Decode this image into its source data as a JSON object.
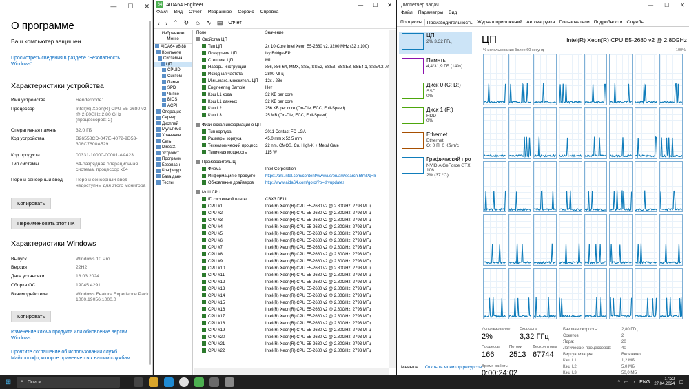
{
  "settings": {
    "title": "О программе",
    "protected": "Ваш компьютер защищен.",
    "security_link": "Просмотреть сведения в разделе \"Безопасность Windows\"",
    "device_specs_title": "Характеристики устройства",
    "device_specs": [
      {
        "k": "Имя устройства",
        "v": "Rendernode1"
      },
      {
        "k": "Процессор",
        "v": "Intel(R) Xeon(R) CPU E5-2680 v2 @ 2.80GHz   2.80 GHz (процессоров: 2)"
      },
      {
        "k": "Оперативная память",
        "v": "32,0 ГБ"
      },
      {
        "k": "Код устройства",
        "v": "B26558CD-047E-4072-9D53-308C7600A529"
      },
      {
        "k": "Код продукта",
        "v": "00331-10000-00001-AA423"
      },
      {
        "k": "Тип системы",
        "v": "64-разрядная операционная система, процессор x64"
      },
      {
        "k": "Перо и сенсорный ввод",
        "v": "Перо и сенсорный ввод недоступны для этого монитора"
      }
    ],
    "copy_label": "Копировать",
    "rename_label": "Переименовать этот ПК",
    "win_specs_title": "Характеристики Windows",
    "win_specs": [
      {
        "k": "Выпуск",
        "v": "Windows 10 Pro"
      },
      {
        "k": "Версия",
        "v": "22H2"
      },
      {
        "k": "Дата установки",
        "v": "18.03.2024"
      },
      {
        "k": "Сборка ОС",
        "v": "19045.4291"
      },
      {
        "k": "Взаимодействие",
        "v": "Windows Feature Experience Pack 1000.19056.1000.0"
      }
    ],
    "copy2_label": "Копировать",
    "link_change_key": "Изменение ключа продукта или обновление версии Windows",
    "link_agreement": "Прочтите соглашение об использовании служб Майкрософт, которое применяется к нашим службам"
  },
  "aida": {
    "title": "AIDA64 Engineer",
    "menu": [
      "Файл",
      "Вид",
      "Отчёт",
      "Избранное",
      "Сервис",
      "Справка"
    ],
    "report": "Отчёт",
    "fav": "Избранное",
    "menu_label": "Меню",
    "tree": [
      "AIDA64 v6.88",
      "Компьюте",
      "Системна",
      "ЦП",
      "CPUID",
      "Систем",
      "Памят",
      "SPD",
      "Чипсе",
      "BIOS",
      "ACPI",
      "Операцио",
      "Сервер",
      "Дисплей",
      "Мультиме",
      "Хранение",
      "Сеть",
      "DirectX",
      "Устройст",
      "Программ",
      "Безопасн",
      "Конфигур",
      "База данн",
      "Тесты"
    ],
    "col_field": "Поле",
    "col_value": "Значение",
    "groups": [
      {
        "name": "Свойства ЦП",
        "rows": [
          {
            "f": "Тип ЦП",
            "v": "2x 10-Core Intel Xeon E5-2680 v2, 3200 MHz (32 x 100)"
          },
          {
            "f": "Псевдоним ЦП",
            "v": "Ivy Bridge-EP"
          },
          {
            "f": "Степпинг ЦП",
            "v": "M1"
          },
          {
            "f": "Наборы инструкций",
            "v": "x86, x86-64, MMX, SSE, SSE2, SSE3, SSSE3, SSE4.1, SSE4.2, AVX, AE"
          },
          {
            "f": "Исходная частота",
            "v": "2800 МГц"
          },
          {
            "f": "Мин./макс. множитель ЦП",
            "v": "12x / 28x"
          },
          {
            "f": "Engineering Sample",
            "v": "Нет"
          },
          {
            "f": "Кэш L1 кода",
            "v": "32 KB per core"
          },
          {
            "f": "Кэш L1 данных",
            "v": "32 KB per core"
          },
          {
            "f": "Кэш L2",
            "v": "256 KB per core  (On-Die, ECC, Full-Speed)"
          },
          {
            "f": "Кэш L3",
            "v": "25 MB  (On-Die, ECC, Full-Speed)"
          }
        ]
      },
      {
        "name": "Физическая информация о ЦП",
        "rows": [
          {
            "f": "Тип корпуса",
            "v": "2011 Contact FC-LGA"
          },
          {
            "f": "Размеры корпуса",
            "v": "45.0 mm x 52.5 mm"
          },
          {
            "f": "Технологический процесс",
            "v": "22 nm, CMOS, Cu, High-K + Metal Gate"
          },
          {
            "f": "Типичная мощность",
            "v": "115 W"
          }
        ]
      },
      {
        "name": "Производитель ЦП",
        "rows": [
          {
            "f": "Фирма",
            "v": "Intel Corporation"
          },
          {
            "f": "Информация о продукте",
            "v": "https://ark.intel.com/content/www/us/en/ark/search.html?q=Ir",
            "link": true
          },
          {
            "f": "Обновление драйверов",
            "v": "http://www.aida64.com/goto/?p=drvupdates",
            "link": true
          }
        ]
      },
      {
        "name": "Multi CPU",
        "rows": [
          {
            "f": "ID системной платы",
            "v": "CBX3 DELL"
          },
          {
            "f": "CPU #1",
            "v": "Intel(R) Xeon(R) CPU E5-2680 v2 @ 2.80GHz, 2793 МГц"
          },
          {
            "f": "CPU #2",
            "v": "Intel(R) Xeon(R) CPU E5-2680 v2 @ 2.80GHz, 2793 МГц"
          },
          {
            "f": "CPU #3",
            "v": "Intel(R) Xeon(R) CPU E5-2680 v2 @ 2.80GHz, 2793 МГц"
          },
          {
            "f": "CPU #4",
            "v": "Intel(R) Xeon(R) CPU E5-2680 v2 @ 2.80GHz, 2793 МГц"
          },
          {
            "f": "CPU #5",
            "v": "Intel(R) Xeon(R) CPU E5-2680 v2 @ 2.80GHz, 2793 МГц"
          },
          {
            "f": "CPU #6",
            "v": "Intel(R) Xeon(R) CPU E5-2680 v2 @ 2.80GHz, 2793 МГц"
          },
          {
            "f": "CPU #7",
            "v": "Intel(R) Xeon(R) CPU E5-2680 v2 @ 2.80GHz, 2793 МГц"
          },
          {
            "f": "CPU #8",
            "v": "Intel(R) Xeon(R) CPU E5-2680 v2 @ 2.80GHz, 2793 МГц"
          },
          {
            "f": "CPU #9",
            "v": "Intel(R) Xeon(R) CPU E5-2680 v2 @ 2.80GHz, 2793 МГц"
          },
          {
            "f": "CPU #10",
            "v": "Intel(R) Xeon(R) CPU E5-2680 v2 @ 2.80GHz, 2793 МГц"
          },
          {
            "f": "CPU #11",
            "v": "Intel(R) Xeon(R) CPU E5-2680 v2 @ 2.80GHz, 2793 МГц"
          },
          {
            "f": "CPU #12",
            "v": "Intel(R) Xeon(R) CPU E5-2680 v2 @ 2.80GHz, 2793 МГц"
          },
          {
            "f": "CPU #13",
            "v": "Intel(R) Xeon(R) CPU E5-2680 v2 @ 2.80GHz, 2793 МГц"
          },
          {
            "f": "CPU #14",
            "v": "Intel(R) Xeon(R) CPU E5-2680 v2 @ 2.80GHz, 2793 МГц"
          },
          {
            "f": "CPU #15",
            "v": "Intel(R) Xeon(R) CPU E5-2680 v2 @ 2.80GHz, 2793 МГц"
          },
          {
            "f": "CPU #16",
            "v": "Intel(R) Xeon(R) CPU E5-2680 v2 @ 2.80GHz, 2793 МГц"
          },
          {
            "f": "CPU #17",
            "v": "Intel(R) Xeon(R) CPU E5-2680 v2 @ 2.80GHz, 2793 МГц"
          },
          {
            "f": "CPU #18",
            "v": "Intel(R) Xeon(R) CPU E5-2680 v2 @ 2.80GHz, 2793 МГц"
          },
          {
            "f": "CPU #19",
            "v": "Intel(R) Xeon(R) CPU E5-2680 v2 @ 2.80GHz, 2793 МГц"
          },
          {
            "f": "CPU #20",
            "v": "Intel(R) Xeon(R) CPU E5-2680 v2 @ 2.80GHz, 2793 МГц"
          },
          {
            "f": "CPU #21",
            "v": "Intel(R) Xeon(R) CPU E5-2680 v2 @ 2.80GHz, 2793 МГц"
          },
          {
            "f": "CPU #22",
            "v": "Intel(R) Xeon(R) CPU E5-2680 v2 @ 2.80GHz, 2793 МГц"
          }
        ]
      }
    ]
  },
  "tm": {
    "title": "Диспетчер задач",
    "menu": [
      "Файл",
      "Параметры",
      "Вид"
    ],
    "tabs": [
      "Процессы",
      "Производительность",
      "Журнал приложений",
      "Автозагрузка",
      "Пользователи",
      "Подробности",
      "Службы"
    ],
    "active_tab": 1,
    "side": [
      {
        "name": "ЦП",
        "sub1": "2% 3,32 ГГц",
        "sub2": "",
        "color": "#117dbb"
      },
      {
        "name": "Память",
        "sub1": "4,4/31,9 ГБ (14%)",
        "sub2": "",
        "color": "#8b12ae"
      },
      {
        "name": "Диск 0 (C: D:)",
        "sub1": "SSD",
        "sub2": "0%",
        "color": "#4da60c"
      },
      {
        "name": "Диск 1 (F:)",
        "sub1": "HDD",
        "sub2": "0%",
        "color": "#4da60c"
      },
      {
        "name": "Ethernet",
        "sub1": "Ethernet",
        "sub2": "О: 0 П: 0 Кбит/с",
        "color": "#a74f01"
      },
      {
        "name": "Графический про",
        "sub1": "NVIDIA GeForce GTX 106",
        "sub2": "2% (37 °C)",
        "color": "#117dbb"
      }
    ],
    "big": "ЦП",
    "cpu_name": "Intel(R) Xeon(R) CPU E5-2680 v2 @ 2.80GHz",
    "sub": "% использования более 60 секунд",
    "hundred": "100%",
    "util_label": "Использование",
    "util": "2%",
    "speed_label": "Скорость",
    "speed": "3,32 ГГц",
    "proc_label": "Процессы",
    "proc": "166",
    "thr_label": "Потоки",
    "thr": "2513",
    "hnd_label": "Дескрипторы",
    "hnd": "67744",
    "up_label": "Время работы",
    "up": "0:00:24:02",
    "right_stats": [
      {
        "k": "Базовая скорость:",
        "v": "2,80 ГГц"
      },
      {
        "k": "Сокетов:",
        "v": "2"
      },
      {
        "k": "Ядра:",
        "v": "20"
      },
      {
        "k": "Логических процессоров:",
        "v": "40"
      },
      {
        "k": "Виртуализация:",
        "v": "Включено"
      },
      {
        "k": "Кэш L1:",
        "v": "1,2 МБ"
      },
      {
        "k": "Кэш L2:",
        "v": "5,0 МБ"
      },
      {
        "k": "Кэш L3:",
        "v": "50,0 МБ"
      }
    ],
    "less": "Меньше",
    "resmon": "Открыть монитор ресурсов",
    "cores": 40
  },
  "taskbar": {
    "search": "Поиск",
    "lang": "ENG",
    "time": "17:32",
    "date": "27.04.2024"
  }
}
